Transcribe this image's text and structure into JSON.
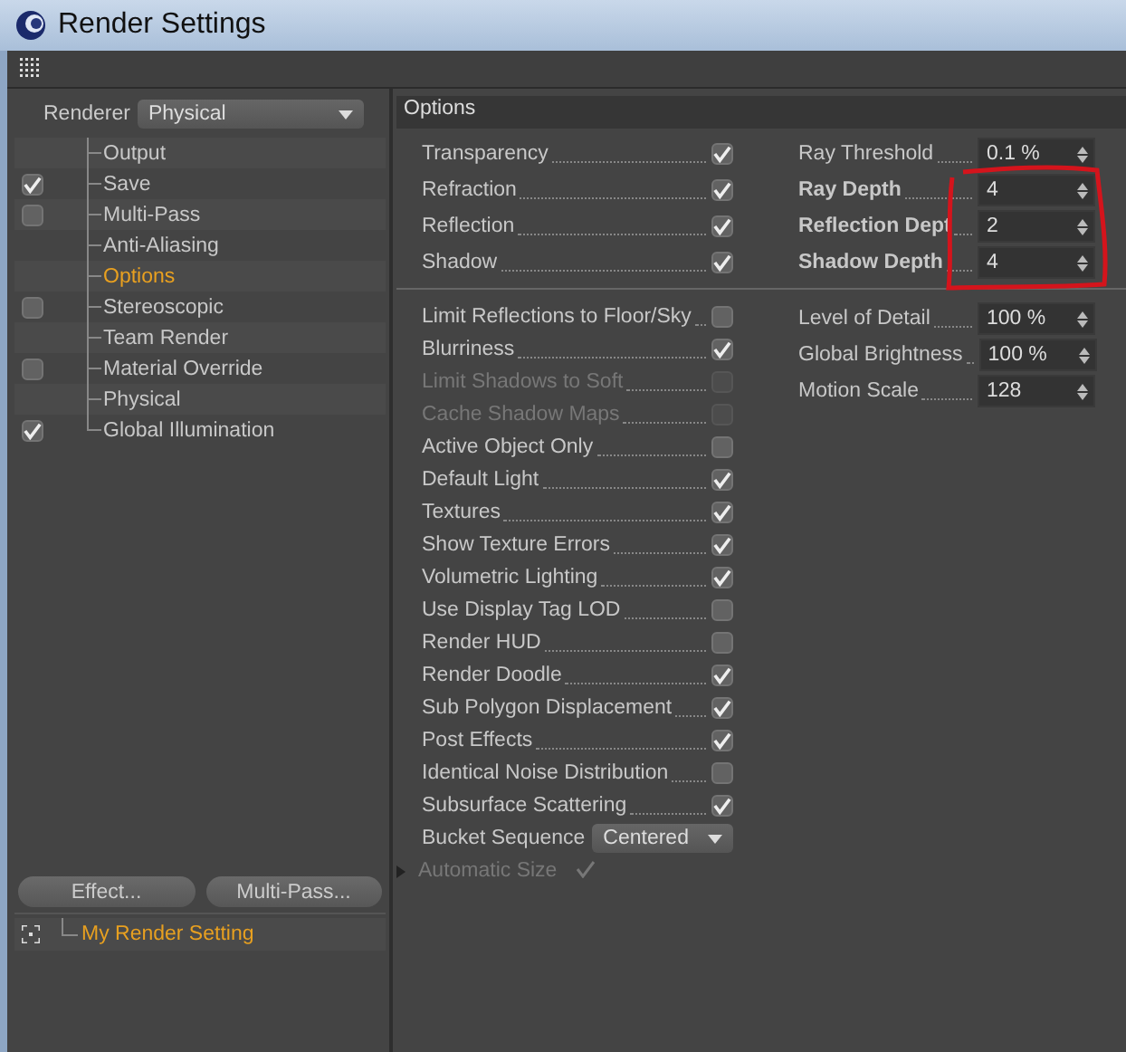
{
  "window": {
    "title": "Render Settings"
  },
  "renderer": {
    "label": "Renderer",
    "value": "Physical"
  },
  "sidebar": {
    "items": [
      {
        "label": "Output",
        "kind": "plain",
        "selected": false
      },
      {
        "label": "Save",
        "kind": "check",
        "checked": true,
        "selected": false
      },
      {
        "label": "Multi-Pass",
        "kind": "check",
        "checked": false,
        "selected": false
      },
      {
        "label": "Anti-Aliasing",
        "kind": "plain",
        "selected": false
      },
      {
        "label": "Options",
        "kind": "plain",
        "selected": true
      },
      {
        "label": "Stereoscopic",
        "kind": "check",
        "checked": false,
        "selected": false
      },
      {
        "label": "Team Render",
        "kind": "plain",
        "selected": false
      },
      {
        "label": "Material Override",
        "kind": "check",
        "checked": false,
        "selected": false
      },
      {
        "label": "Physical",
        "kind": "plain",
        "selected": false
      },
      {
        "label": "Global Illumination",
        "kind": "check",
        "checked": true,
        "selected": false
      }
    ],
    "buttons": [
      "Effect...",
      "Multi-Pass..."
    ],
    "presets": [
      {
        "label": "My Render Setting",
        "selected": true
      }
    ]
  },
  "options": {
    "title": "Options",
    "top_checks": [
      {
        "label": "Transparency",
        "checked": true,
        "disabled": false
      },
      {
        "label": "Refraction",
        "checked": true,
        "disabled": false
      },
      {
        "label": "Reflection",
        "checked": true,
        "disabled": false
      },
      {
        "label": "Shadow",
        "checked": true,
        "disabled": false
      }
    ],
    "top_fields": [
      {
        "label": "Ray Threshold",
        "value": "0.1 %",
        "bold": false
      },
      {
        "label": "Ray Depth",
        "value": "4",
        "bold": true
      },
      {
        "label": "Reflection Dept",
        "value": "2",
        "bold": true
      },
      {
        "label": "Shadow Depth",
        "value": "4",
        "bold": true
      }
    ],
    "rows": [
      {
        "kind": "check",
        "label": "Limit Reflections to Floor/Sky",
        "checked": false,
        "disabled": false
      },
      {
        "kind": "check",
        "label": "Blurriness",
        "checked": true,
        "disabled": false
      },
      {
        "kind": "check",
        "label": "Limit Shadows to Soft",
        "checked": false,
        "disabled": true
      },
      {
        "kind": "check",
        "label": "Cache Shadow Maps",
        "checked": false,
        "disabled": true
      },
      {
        "kind": "check",
        "label": "Active Object Only",
        "checked": false,
        "disabled": false
      },
      {
        "kind": "check",
        "label": "Default Light",
        "checked": true,
        "disabled": false
      },
      {
        "kind": "check",
        "label": "Textures",
        "checked": true,
        "disabled": false
      },
      {
        "kind": "check",
        "label": "Show Texture Errors",
        "checked": true,
        "disabled": false
      },
      {
        "kind": "check",
        "label": "Volumetric Lighting",
        "checked": true,
        "disabled": false
      },
      {
        "kind": "check",
        "label": "Use Display Tag LOD",
        "checked": false,
        "disabled": false
      },
      {
        "kind": "check",
        "label": "Render HUD",
        "checked": false,
        "disabled": false
      },
      {
        "kind": "check",
        "label": "Render Doodle",
        "checked": true,
        "disabled": false
      },
      {
        "kind": "check",
        "label": "Sub Polygon Displacement",
        "checked": true,
        "disabled": false
      },
      {
        "kind": "check",
        "label": "Post Effects",
        "checked": true,
        "disabled": false
      },
      {
        "kind": "check",
        "label": "Identical Noise Distribution",
        "checked": false,
        "disabled": false
      },
      {
        "kind": "check",
        "label": "Subsurface Scattering",
        "checked": true,
        "disabled": false
      },
      {
        "kind": "dropdown",
        "label": "Bucket Sequence",
        "value": "Centered",
        "disabled": false
      },
      {
        "kind": "expander",
        "label": "Automatic Size",
        "checked": true,
        "disabled": true,
        "expanded": false
      }
    ],
    "fields": [
      {
        "label": "Level of Detail",
        "value": "100 %",
        "bold": false
      },
      {
        "label": "Global Brightness",
        "value": "100 %",
        "bold": false
      },
      {
        "label": "Motion Scale",
        "value": "128",
        "bold": false
      }
    ]
  }
}
